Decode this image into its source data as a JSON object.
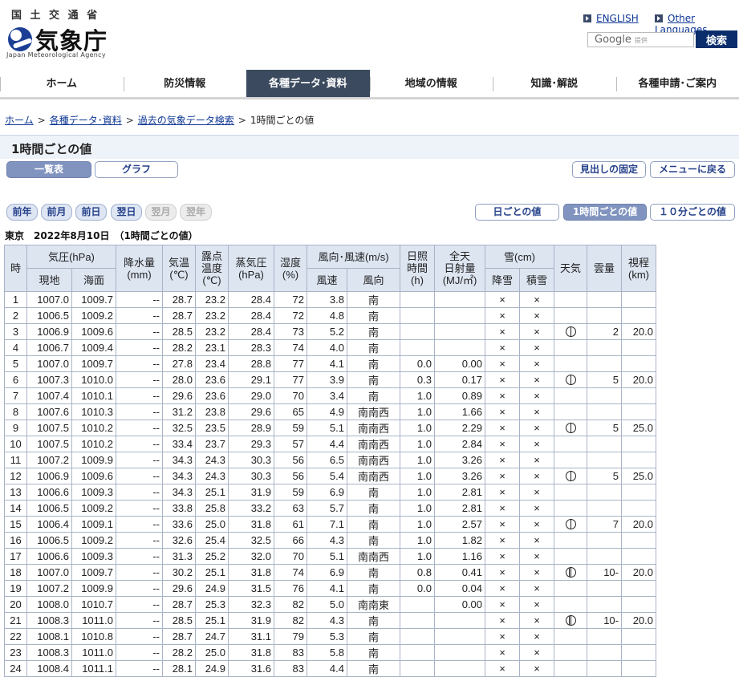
{
  "header": {
    "ministry": "国 土 交 通 省",
    "logo_text": "気象庁",
    "logo_sub": "Japan Meteorological Agency",
    "lang_english": "ENGLISH",
    "lang_other": "Other Languages",
    "search_placeholder": "Google",
    "search_powered": "提供",
    "search_button": "検索"
  },
  "nav": [
    "ホーム",
    "防災情報",
    "各種データ･資料",
    "地域の情報",
    "知識･解説",
    "各種申請･ご案内"
  ],
  "breadcrumb": [
    "ホーム",
    "各種データ･資料",
    "過去の気象データ検索",
    "1時間ごとの値"
  ],
  "page_title": "1時間ごとの値",
  "view_buttons": {
    "table": "一覧表",
    "graph": "グラフ"
  },
  "right_buttons": {
    "fix_header": "見出しの固定",
    "back_menu": "メニューに戻る"
  },
  "date_nav": {
    "prev_year": "前年",
    "prev_month": "前月",
    "prev_day": "前日",
    "next_day": "翌日",
    "next_month": "翌月",
    "next_year": "翌年"
  },
  "period_buttons": {
    "daily": "日ごとの値",
    "hourly": "1時間ごとの値",
    "tenmin": "１０分ごとの値"
  },
  "location_line": "東京　2022年8月10日　（1時間ごとの値）",
  "table_header": {
    "hour": "時",
    "pressure": "気圧(hPa)",
    "station": "現地",
    "sea": "海面",
    "precip": "降水量",
    "precip_unit": "(mm)",
    "temp": "気温",
    "temp_unit": "(℃)",
    "dew": "露点",
    "dew2": "温度",
    "dew_unit": "(℃)",
    "vapor": "蒸気圧",
    "vapor_unit": "(hPa)",
    "humidity": "湿度",
    "humidity_unit": "(%)",
    "wind": "風向･風速(m/s)",
    "wind_speed": "風速",
    "wind_dir": "風向",
    "sunshine": "日照",
    "sunshine2": "時間",
    "sunshine_unit": "(h)",
    "radiation": "全天",
    "radiation2": "日射量",
    "radiation_unit": "(MJ/㎡)",
    "snow": "雪(cm)",
    "snowfall": "降雪",
    "snowdepth": "積雪",
    "weather": "天気",
    "cloud": "雲量",
    "visibility": "視程",
    "visibility_unit": "(km)"
  },
  "rows": [
    {
      "h": "1",
      "p": "1007.0",
      "sp": "1009.7",
      "pr": "--",
      "t": "28.7",
      "dp": "23.2",
      "vp": "28.4",
      "hu": "72",
      "ws": "3.8",
      "wd": "南",
      "sun": "",
      "rad": "",
      "sf": "×",
      "sd": "×",
      "wx": "",
      "cl": "",
      "vis": ""
    },
    {
      "h": "2",
      "p": "1006.5",
      "sp": "1009.2",
      "pr": "--",
      "t": "28.7",
      "dp": "23.2",
      "vp": "28.4",
      "hu": "72",
      "ws": "4.8",
      "wd": "南",
      "sun": "",
      "rad": "",
      "sf": "×",
      "sd": "×",
      "wx": "",
      "cl": "",
      "vis": ""
    },
    {
      "h": "3",
      "p": "1006.9",
      "sp": "1009.6",
      "pr": "--",
      "t": "28.5",
      "dp": "23.2",
      "vp": "28.4",
      "hu": "73",
      "ws": "5.2",
      "wd": "南",
      "sun": "",
      "rad": "",
      "sf": "×",
      "sd": "×",
      "wx": "cloudy",
      "cl": "2",
      "vis": "20.0"
    },
    {
      "h": "4",
      "p": "1006.7",
      "sp": "1009.4",
      "pr": "--",
      "t": "28.2",
      "dp": "23.1",
      "vp": "28.3",
      "hu": "74",
      "ws": "4.0",
      "wd": "南",
      "sun": "",
      "rad": "",
      "sf": "×",
      "sd": "×",
      "wx": "",
      "cl": "",
      "vis": ""
    },
    {
      "h": "5",
      "p": "1007.0",
      "sp": "1009.7",
      "pr": "--",
      "t": "27.8",
      "dp": "23.4",
      "vp": "28.8",
      "hu": "77",
      "ws": "4.1",
      "wd": "南",
      "sun": "0.0",
      "rad": "0.00",
      "sf": "×",
      "sd": "×",
      "wx": "",
      "cl": "",
      "vis": ""
    },
    {
      "h": "6",
      "p": "1007.3",
      "sp": "1010.0",
      "pr": "--",
      "t": "28.0",
      "dp": "23.6",
      "vp": "29.1",
      "hu": "77",
      "ws": "3.9",
      "wd": "南",
      "sun": "0.3",
      "rad": "0.17",
      "sf": "×",
      "sd": "×",
      "wx": "cloudy",
      "cl": "5",
      "vis": "20.0"
    },
    {
      "h": "7",
      "p": "1007.4",
      "sp": "1010.1",
      "pr": "--",
      "t": "29.6",
      "dp": "23.6",
      "vp": "29.0",
      "hu": "70",
      "ws": "3.4",
      "wd": "南",
      "sun": "1.0",
      "rad": "0.89",
      "sf": "×",
      "sd": "×",
      "wx": "",
      "cl": "",
      "vis": ""
    },
    {
      "h": "8",
      "p": "1007.6",
      "sp": "1010.3",
      "pr": "--",
      "t": "31.2",
      "dp": "23.8",
      "vp": "29.6",
      "hu": "65",
      "ws": "4.9",
      "wd": "南南西",
      "sun": "1.0",
      "rad": "1.66",
      "sf": "×",
      "sd": "×",
      "wx": "",
      "cl": "",
      "vis": ""
    },
    {
      "h": "9",
      "p": "1007.5",
      "sp": "1010.2",
      "pr": "--",
      "t": "32.5",
      "dp": "23.5",
      "vp": "28.9",
      "hu": "59",
      "ws": "5.1",
      "wd": "南南西",
      "sun": "1.0",
      "rad": "2.29",
      "sf": "×",
      "sd": "×",
      "wx": "cloudy",
      "cl": "5",
      "vis": "25.0"
    },
    {
      "h": "10",
      "p": "1007.5",
      "sp": "1010.2",
      "pr": "--",
      "t": "33.4",
      "dp": "23.7",
      "vp": "29.3",
      "hu": "57",
      "ws": "4.4",
      "wd": "南南西",
      "sun": "1.0",
      "rad": "2.84",
      "sf": "×",
      "sd": "×",
      "wx": "",
      "cl": "",
      "vis": ""
    },
    {
      "h": "11",
      "p": "1007.2",
      "sp": "1009.9",
      "pr": "--",
      "t": "34.3",
      "dp": "24.3",
      "vp": "30.3",
      "hu": "56",
      "ws": "6.5",
      "wd": "南南西",
      "sun": "1.0",
      "rad": "3.26",
      "sf": "×",
      "sd": "×",
      "wx": "",
      "cl": "",
      "vis": ""
    },
    {
      "h": "12",
      "p": "1006.9",
      "sp": "1009.6",
      "pr": "--",
      "t": "34.3",
      "dp": "24.3",
      "vp": "30.3",
      "hu": "56",
      "ws": "5.4",
      "wd": "南南西",
      "sun": "1.0",
      "rad": "3.26",
      "sf": "×",
      "sd": "×",
      "wx": "cloudy",
      "cl": "5",
      "vis": "25.0"
    },
    {
      "h": "13",
      "p": "1006.6",
      "sp": "1009.3",
      "pr": "--",
      "t": "34.3",
      "dp": "25.1",
      "vp": "31.9",
      "hu": "59",
      "ws": "6.9",
      "wd": "南",
      "sun": "1.0",
      "rad": "2.81",
      "sf": "×",
      "sd": "×",
      "wx": "",
      "cl": "",
      "vis": ""
    },
    {
      "h": "14",
      "p": "1006.5",
      "sp": "1009.2",
      "pr": "--",
      "t": "33.8",
      "dp": "25.8",
      "vp": "33.2",
      "hu": "63",
      "ws": "5.7",
      "wd": "南",
      "sun": "1.0",
      "rad": "2.81",
      "sf": "×",
      "sd": "×",
      "wx": "",
      "cl": "",
      "vis": ""
    },
    {
      "h": "15",
      "p": "1006.4",
      "sp": "1009.1",
      "pr": "--",
      "t": "33.6",
      "dp": "25.0",
      "vp": "31.8",
      "hu": "61",
      "ws": "7.1",
      "wd": "南",
      "sun": "1.0",
      "rad": "2.57",
      "sf": "×",
      "sd": "×",
      "wx": "cloudy",
      "cl": "7",
      "vis": "20.0"
    },
    {
      "h": "16",
      "p": "1006.5",
      "sp": "1009.2",
      "pr": "--",
      "t": "32.6",
      "dp": "25.4",
      "vp": "32.5",
      "hu": "66",
      "ws": "4.3",
      "wd": "南",
      "sun": "1.0",
      "rad": "1.82",
      "sf": "×",
      "sd": "×",
      "wx": "",
      "cl": "",
      "vis": ""
    },
    {
      "h": "17",
      "p": "1006.6",
      "sp": "1009.3",
      "pr": "--",
      "t": "31.3",
      "dp": "25.2",
      "vp": "32.0",
      "hu": "70",
      "ws": "5.1",
      "wd": "南南西",
      "sun": "1.0",
      "rad": "1.16",
      "sf": "×",
      "sd": "×",
      "wx": "",
      "cl": "",
      "vis": ""
    },
    {
      "h": "18",
      "p": "1007.0",
      "sp": "1009.7",
      "pr": "--",
      "t": "30.2",
      "dp": "25.1",
      "vp": "31.8",
      "hu": "74",
      "ws": "6.9",
      "wd": "南",
      "sun": "0.8",
      "rad": "0.41",
      "sf": "×",
      "sd": "×",
      "wx": "overcast",
      "cl": "10-",
      "vis": "20.0"
    },
    {
      "h": "19",
      "p": "1007.2",
      "sp": "1009.9",
      "pr": "--",
      "t": "29.6",
      "dp": "24.9",
      "vp": "31.5",
      "hu": "76",
      "ws": "4.1",
      "wd": "南",
      "sun": "0.0",
      "rad": "0.04",
      "sf": "×",
      "sd": "×",
      "wx": "",
      "cl": "",
      "vis": ""
    },
    {
      "h": "20",
      "p": "1008.0",
      "sp": "1010.7",
      "pr": "--",
      "t": "28.7",
      "dp": "25.3",
      "vp": "32.3",
      "hu": "82",
      "ws": "5.0",
      "wd": "南南東",
      "sun": "",
      "rad": "0.00",
      "sf": "×",
      "sd": "×",
      "wx": "",
      "cl": "",
      "vis": ""
    },
    {
      "h": "21",
      "p": "1008.3",
      "sp": "1011.0",
      "pr": "--",
      "t": "28.5",
      "dp": "25.1",
      "vp": "31.9",
      "hu": "82",
      "ws": "4.3",
      "wd": "南",
      "sun": "",
      "rad": "",
      "sf": "×",
      "sd": "×",
      "wx": "overcast",
      "cl": "10-",
      "vis": "20.0"
    },
    {
      "h": "22",
      "p": "1008.1",
      "sp": "1010.8",
      "pr": "--",
      "t": "28.7",
      "dp": "24.7",
      "vp": "31.1",
      "hu": "79",
      "ws": "5.3",
      "wd": "南",
      "sun": "",
      "rad": "",
      "sf": "×",
      "sd": "×",
      "wx": "",
      "cl": "",
      "vis": ""
    },
    {
      "h": "23",
      "p": "1008.3",
      "sp": "1011.0",
      "pr": "--",
      "t": "28.2",
      "dp": "25.0",
      "vp": "31.8",
      "hu": "83",
      "ws": "5.8",
      "wd": "南",
      "sun": "",
      "rad": "",
      "sf": "×",
      "sd": "×",
      "wx": "",
      "cl": "",
      "vis": ""
    },
    {
      "h": "24",
      "p": "1008.4",
      "sp": "1011.1",
      "pr": "--",
      "t": "28.1",
      "dp": "24.9",
      "vp": "31.6",
      "hu": "83",
      "ws": "4.4",
      "wd": "南",
      "sun": "",
      "rad": "",
      "sf": "×",
      "sd": "×",
      "wx": "",
      "cl": "",
      "vis": ""
    }
  ]
}
